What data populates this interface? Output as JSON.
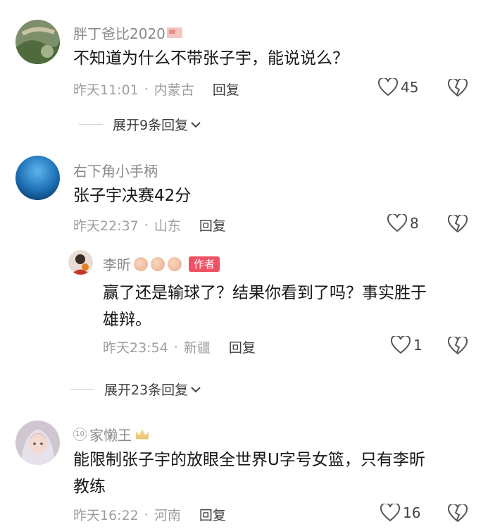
{
  "comments": [
    {
      "user": "胖丁爸比2020",
      "text": "不知道为什么不带张子宇，能说说么？",
      "time": "昨天11:01",
      "location": "内蒙古",
      "reply_label": "回复",
      "likes": "45",
      "expand_label": "展开9条回复"
    },
    {
      "user": "右下角小手柄",
      "text": "张子宇决赛42分",
      "time": "昨天22:37",
      "location": "山东",
      "reply_label": "回复",
      "likes": "8",
      "reply": {
        "user": "李昕",
        "author_tag": "作者",
        "text_line1": "赢了还是输球了？结果你看到了吗？事实胜于",
        "text_line2": "雄辩。",
        "time": "昨天23:54",
        "location": "新疆",
        "reply_label": "回复",
        "likes": "1"
      },
      "expand_label": "展开23条回复"
    },
    {
      "user": "家懒王",
      "level": "10",
      "text_line1": "能限制张子宇的放眼全世界U字号女篮，只有李昕",
      "text_line2": "教练",
      "time": "昨天16:22",
      "location": "河南",
      "reply_label": "回复",
      "likes": "16"
    }
  ],
  "icons": {
    "like": "heart-outline",
    "dislike": "broken-heart-outline",
    "expand": "chevron-down"
  },
  "colors": {
    "author_tag": "#ef5264",
    "meta": "#9d9d9d",
    "username": "#8a8a8a"
  }
}
